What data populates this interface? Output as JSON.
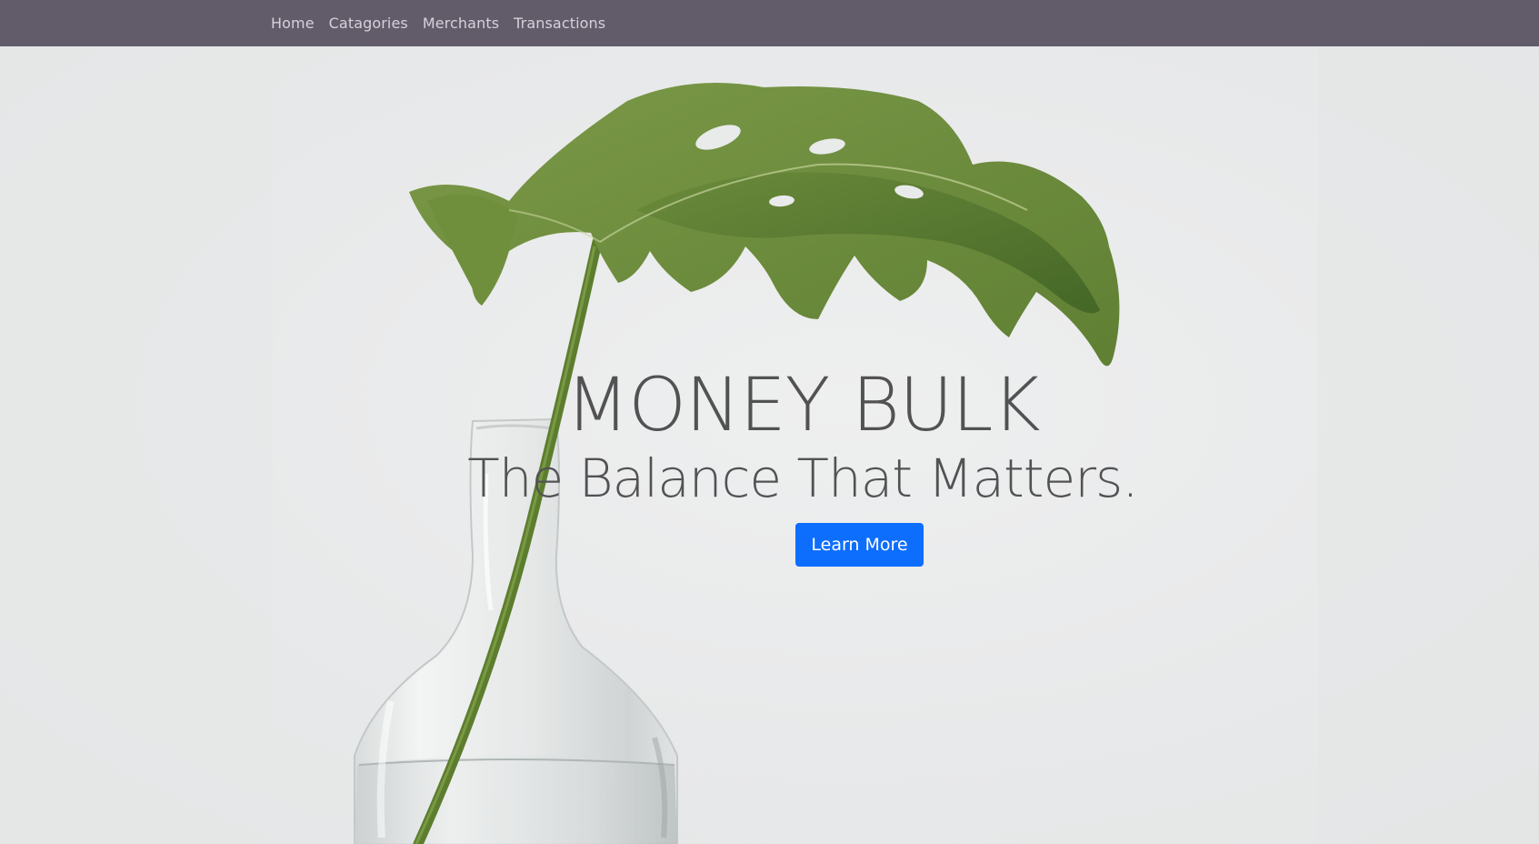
{
  "nav": {
    "items": [
      {
        "label": "Home"
      },
      {
        "label": "Catagories"
      },
      {
        "label": "Merchants"
      },
      {
        "label": "Transactions"
      }
    ]
  },
  "hero": {
    "title": "MONEY BULK",
    "subtitle": "The Balance That Matters.",
    "button_label": "Learn More",
    "background_image": "monstera-leaf-in-glass-vase"
  },
  "colors": {
    "navbar": "#625c6a",
    "nav_text": "#d5d1da",
    "hero_text": "#525254",
    "button": "#0d6efd",
    "button_text": "#ffffff"
  }
}
